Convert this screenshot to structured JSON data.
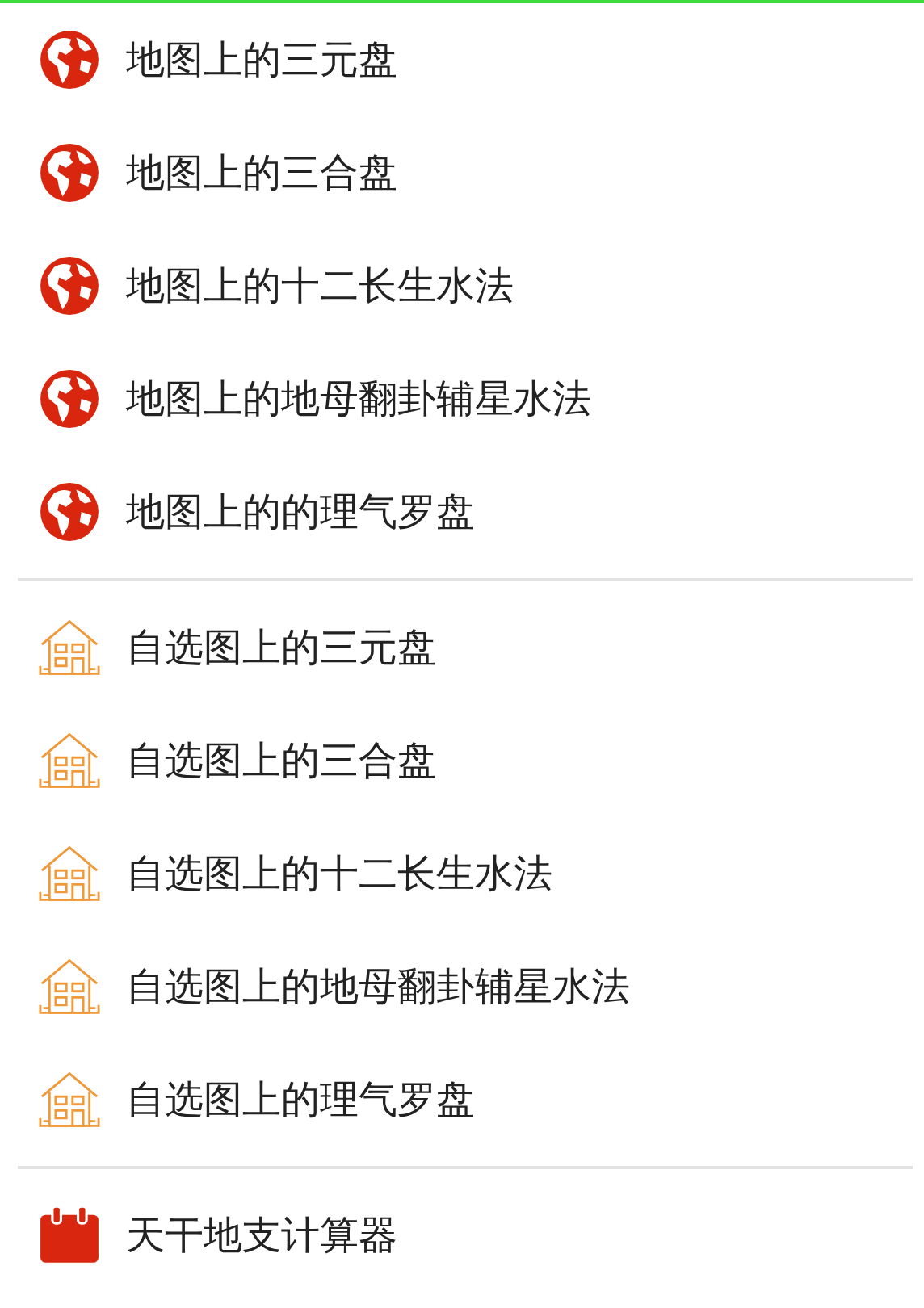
{
  "sections": [
    {
      "kind": "globe",
      "items": [
        "地图上的三元盘",
        "地图上的三合盘",
        "地图上的十二长生水法",
        "地图上的地母翻卦辅星水法",
        "地图上的的理气罗盘"
      ]
    },
    {
      "kind": "house",
      "items": [
        "自选图上的三元盘",
        "自选图上的三合盘",
        "自选图上的十二长生水法",
        "自选图上的地母翻卦辅星水法",
        "自选图上的理气罗盘"
      ]
    },
    {
      "kind": "calendar",
      "items": [
        "天干地支计算器"
      ]
    }
  ]
}
